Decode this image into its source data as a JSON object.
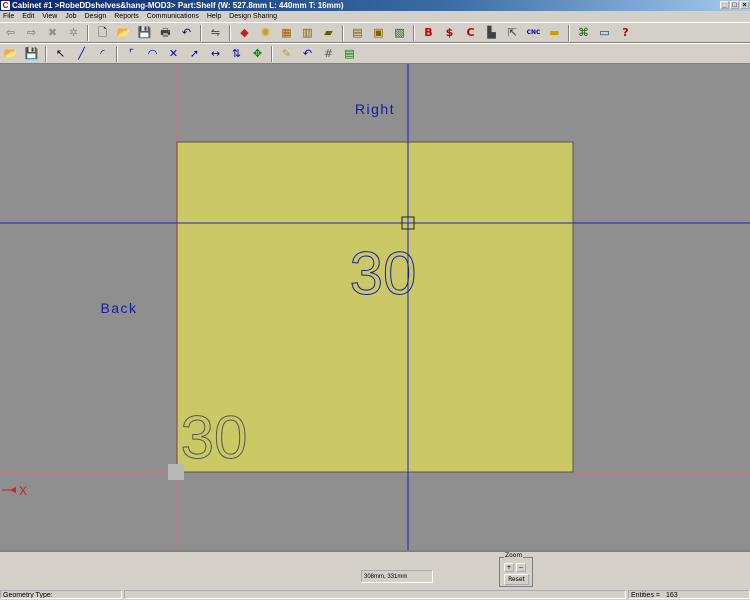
{
  "window": {
    "title": "Cabinet #1 >RobeDDshelves&hang-MOD3> Part:Shelf (W: 527.8mm L: 440mm T: 16mm)",
    "controls": [
      "_",
      "□",
      "×"
    ]
  },
  "menu": [
    "File",
    "Edit",
    "View",
    "Job",
    "Design",
    "Reports",
    "Communications",
    "Help",
    "Design Sharing"
  ],
  "toolbar_top": {
    "items": [
      {
        "name": "back-arrow-icon",
        "glyph": "⇦",
        "color": "#707070"
      },
      {
        "name": "forward-arrow-icon",
        "glyph": "⇨",
        "color": "#707070"
      },
      {
        "name": "stop-icon",
        "glyph": "✖",
        "color": "#909090"
      },
      {
        "name": "gear-icon",
        "glyph": "✲",
        "color": "#909090"
      },
      {
        "name": "sep"
      },
      {
        "name": "new-file-icon",
        "glyph": "🗋",
        "color": "#000000"
      },
      {
        "name": "open-folder-icon",
        "glyph": "📂",
        "color": "#c8a000"
      },
      {
        "name": "save-icon",
        "glyph": "💾",
        "color": "#000080"
      },
      {
        "name": "print-icon",
        "glyph": "🖶",
        "color": "#404040"
      },
      {
        "name": "undo-icon",
        "glyph": "↶",
        "color": "#000080"
      },
      {
        "name": "sep"
      },
      {
        "name": "properties-icon",
        "glyph": "⇋",
        "color": "#404040"
      },
      {
        "name": "sep"
      },
      {
        "name": "colors-icon",
        "glyph": "◆",
        "color": "#c02020"
      },
      {
        "name": "lighting-icon",
        "glyph": "✺",
        "color": "#c8a000"
      },
      {
        "name": "edit-panel-icon",
        "glyph": "▦",
        "color": "#a06000"
      },
      {
        "name": "door-icon",
        "glyph": "▥",
        "color": "#806000"
      },
      {
        "name": "material-icon",
        "glyph": "▰",
        "color": "#606000"
      },
      {
        "name": "sep"
      },
      {
        "name": "cabinet-icon",
        "glyph": "▤",
        "color": "#806000"
      },
      {
        "name": "cabinets-icon",
        "glyph": "▣",
        "color": "#806000"
      },
      {
        "name": "layout-icon",
        "glyph": "▧",
        "color": "#206020"
      },
      {
        "name": "sep"
      },
      {
        "name": "report-b-icon",
        "glyph": "B",
        "color": "#c00000"
      },
      {
        "name": "report-dollar-icon",
        "glyph": "$",
        "color": "#c00000"
      },
      {
        "name": "report-c-icon",
        "glyph": "C",
        "color": "#c00000"
      },
      {
        "name": "optimize-icon",
        "glyph": "▙",
        "color": "#404040"
      },
      {
        "name": "export-icon",
        "glyph": "⇱",
        "color": "#404040"
      },
      {
        "name": "cnc-icon",
        "glyph": "CNC",
        "color": "#0000c0"
      },
      {
        "name": "labels-icon",
        "glyph": "▬",
        "color": "#c8a000"
      },
      {
        "name": "sep"
      },
      {
        "name": "network-icon",
        "glyph": "⌘",
        "color": "#206020"
      },
      {
        "name": "monitor-icon",
        "glyph": "▭",
        "color": "#004080"
      },
      {
        "name": "help-icon",
        "glyph": "?",
        "color": "#c00000"
      }
    ]
  },
  "toolbar_draw": {
    "items": [
      {
        "name": "open-folder-icon",
        "glyph": "📂",
        "color": "#c8a000"
      },
      {
        "name": "save-icon",
        "glyph": "💾",
        "color": "#000080"
      },
      {
        "name": "sep"
      },
      {
        "name": "select-arrow-icon",
        "glyph": "↖",
        "color": "#000000"
      },
      {
        "name": "line-tool-icon",
        "glyph": "╱",
        "color": "#0000c0"
      },
      {
        "name": "arc-tool-icon",
        "glyph": "◜",
        "color": "#0000c0"
      },
      {
        "name": "sep"
      },
      {
        "name": "fillet-tool-icon",
        "glyph": "⌜",
        "color": "#0000c0"
      },
      {
        "name": "round-corner-icon",
        "glyph": "◠",
        "color": "#0000c0"
      },
      {
        "name": "trim-tool-icon",
        "glyph": "✕",
        "color": "#0000c0"
      },
      {
        "name": "extend-tool-icon",
        "glyph": "➚",
        "color": "#0000c0"
      },
      {
        "name": "dimension-tool-icon",
        "glyph": "↔",
        "color": "#0000c0"
      },
      {
        "name": "mirror-tool-icon",
        "glyph": "⇅",
        "color": "#0000c0"
      },
      {
        "name": "move-tool-icon",
        "glyph": "✥",
        "color": "#008000"
      },
      {
        "name": "sep"
      },
      {
        "name": "erase-tool-icon",
        "glyph": "✎",
        "color": "#c8a000"
      },
      {
        "name": "undo-draw-icon",
        "glyph": "↶",
        "color": "#0000c0"
      },
      {
        "name": "grid-icon",
        "glyph": "#",
        "color": "#606060"
      },
      {
        "name": "layers-icon",
        "glyph": "▤",
        "color": "#008000"
      }
    ]
  },
  "drawing": {
    "panel_color": "#cbc965",
    "background_color": "#8f8f8f",
    "crosshair_color": "#1f1fd6",
    "label_right": "Right",
    "label_back": "Back",
    "number_center": "30",
    "number_corner": "30",
    "origin_label": "X"
  },
  "bottom": {
    "coordinates": "308mm, 331mm",
    "zoom_label": "Zoom",
    "zoom_in": "+",
    "zoom_out": "−",
    "reset_label": "Reset"
  },
  "status": {
    "geometry_label": "Geometry Type:",
    "entities_label": "Entities =",
    "entities_value": "163"
  }
}
